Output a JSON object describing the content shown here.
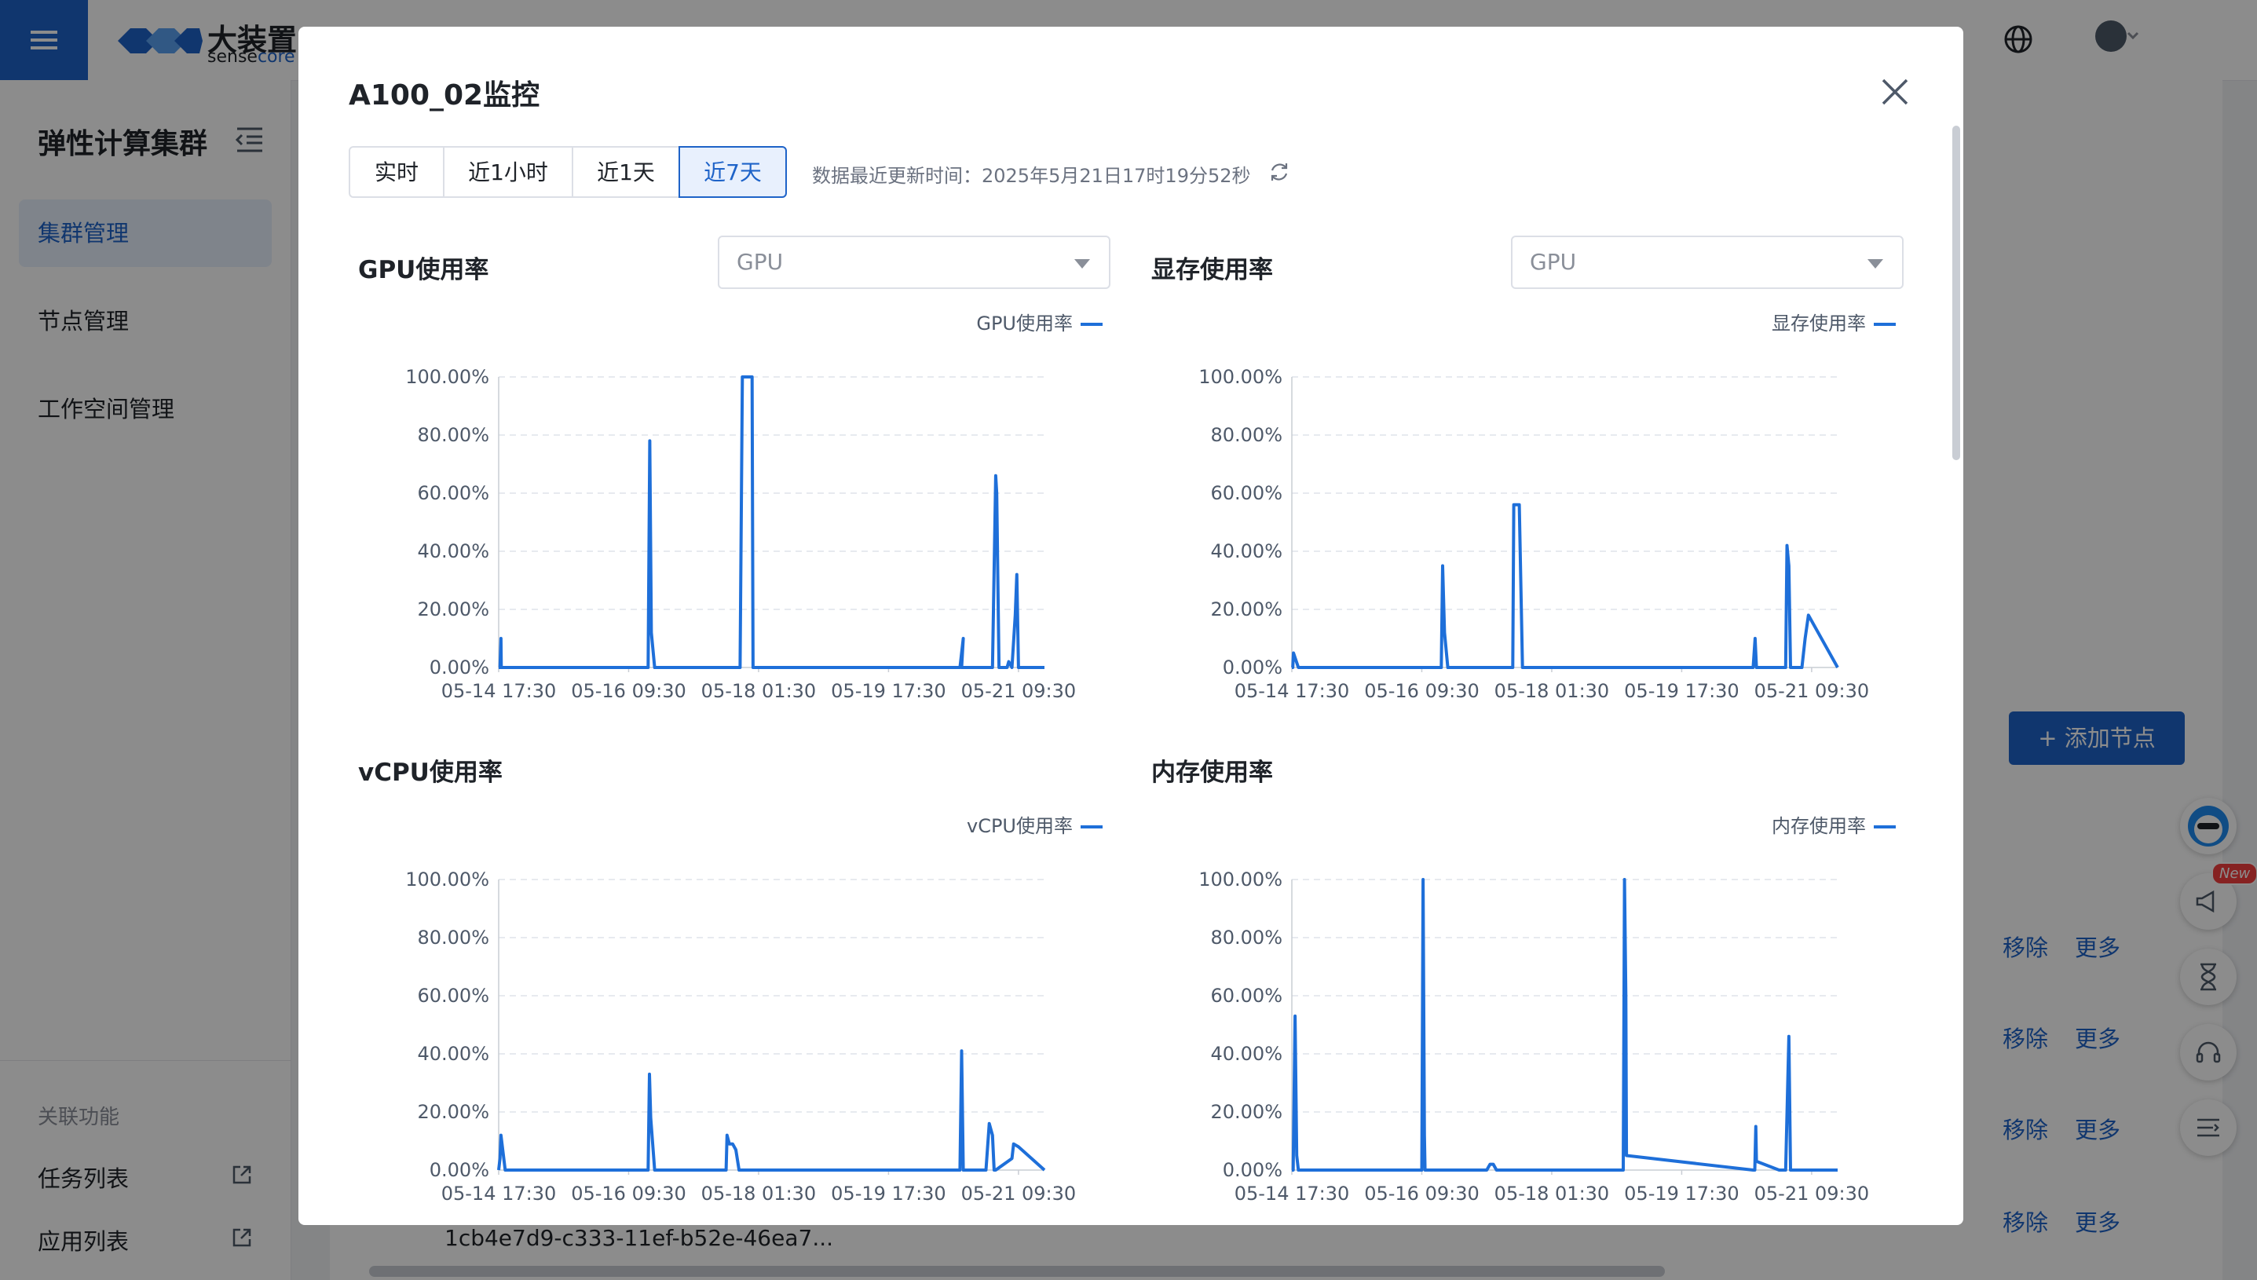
{
  "app": {
    "logo_title": "大装置",
    "logo_sub_prefix": "sense",
    "logo_sub_accent": "core"
  },
  "sidebar": {
    "title": "弹性计算集群",
    "items": [
      {
        "label": "集群管理",
        "active": true
      },
      {
        "label": "节点管理",
        "active": false
      },
      {
        "label": "工作空间管理",
        "active": false
      }
    ],
    "related_label": "关联功能",
    "links": [
      {
        "label": "任务列表"
      },
      {
        "label": "应用列表"
      }
    ]
  },
  "background": {
    "add_node_button": "+ 添加节点",
    "row_actions": [
      {
        "remove": "移除",
        "more": "更多"
      },
      {
        "remove": "移除",
        "more": "更多"
      },
      {
        "remove": "移除",
        "more": "更多"
      },
      {
        "remove": "移除",
        "more": "更多"
      }
    ],
    "row_id": "1cb4e7d9-c333-11ef-b52e-46ea7...",
    "new_badge": "New"
  },
  "modal": {
    "title": "A100_02监控",
    "time_ranges": [
      "实时",
      "近1小时",
      "近1天",
      "近7天"
    ],
    "active_range": "近7天",
    "update_label": "数据最近更新时间：2025年5月21日17时19分52秒",
    "gpu_select_placeholder": "GPU",
    "mem_select_placeholder": "GPU"
  },
  "colors": {
    "accent": "#1e63c8",
    "series": "#1e6fd9",
    "grid": "#dfe3ea"
  },
  "chart_data": [
    {
      "type": "line",
      "title": "GPU使用率",
      "legend": [
        "GPU使用率"
      ],
      "legend_position": "top-right",
      "x_tick_labels": [
        "05-14 17:30",
        "05-16 09:30",
        "05-18 01:30",
        "05-19 17:30",
        "05-21 09:30"
      ],
      "y_tick_labels": [
        "0.00%",
        "20.00%",
        "40.00%",
        "60.00%",
        "80.00%",
        "100.00%"
      ],
      "ylim": [
        0,
        100
      ],
      "xlim_hours": [
        0,
        168
      ],
      "grid": true,
      "series": [
        {
          "name": "GPU使用率",
          "x_hours_since_first_tick": [
            0,
            0.4,
            0.7,
            0.8,
            2,
            46,
            46.5,
            47,
            48,
            60,
            74.3,
            75,
            76,
            78,
            78.3,
            80,
            142,
            143,
            142.5,
            152,
            153,
            153.3,
            154,
            155,
            156,
            156.5,
            157,
            158,
            159,
            159.5,
            160,
            168
          ],
          "y": [
            0,
            0,
            10,
            0,
            0,
            0,
            78,
            12,
            0,
            0,
            0,
            100,
            100,
            100,
            0,
            0,
            0,
            10,
            0,
            0,
            66,
            60,
            0,
            0,
            0,
            0,
            2,
            0,
            18,
            32,
            0,
            0
          ]
        }
      ]
    },
    {
      "type": "line",
      "title": "显存使用率",
      "legend": [
        "显存使用率"
      ],
      "legend_position": "top-right",
      "x_tick_labels": [
        "05-14 17:30",
        "05-16 09:30",
        "05-18 01:30",
        "05-19 17:30",
        "05-21 09:30"
      ],
      "y_tick_labels": [
        "0.00%",
        "20.00%",
        "40.00%",
        "60.00%",
        "80.00%",
        "100.00%"
      ],
      "ylim": [
        0,
        100
      ],
      "xlim_hours": [
        0,
        168
      ],
      "grid": true,
      "series": [
        {
          "name": "显存使用率",
          "x_hours_since_first_tick": [
            0,
            0.3,
            0.5,
            2,
            46,
            46.4,
            47,
            48,
            60,
            62,
            68,
            68.3,
            69.5,
            70,
            71,
            142,
            142.6,
            143,
            152,
            152.4,
            153,
            153.5,
            155,
            156,
            157,
            158,
            159,
            168
          ],
          "y": [
            0,
            0,
            5,
            0,
            0,
            35,
            12,
            0,
            0,
            0,
            0,
            56,
            56,
            56,
            0,
            0,
            10,
            0,
            0,
            42,
            35,
            0,
            0,
            0,
            0,
            10,
            18,
            0
          ]
        }
      ]
    },
    {
      "type": "line",
      "title": "vCPU使用率",
      "legend": [
        "vCPU使用率"
      ],
      "legend_position": "top-right",
      "x_tick_labels": [
        "05-14 17:30",
        "05-16 09:30",
        "05-18 01:30",
        "05-19 17:30",
        "05-21 09:30"
      ],
      "y_tick_labels": [
        "0.00%",
        "20.00%",
        "40.00%",
        "60.00%",
        "80.00%",
        "100.00%"
      ],
      "ylim": [
        0,
        100
      ],
      "xlim_hours": [
        0,
        168
      ],
      "grid": true,
      "series": [
        {
          "name": "vCPU使用率",
          "x_hours_since_first_tick": [
            0,
            0.4,
            0.7,
            2,
            46,
            46.4,
            46.8,
            48,
            70,
            70.3,
            71,
            72,
            73,
            74,
            142,
            142.5,
            143,
            150,
            151,
            152,
            152.5,
            153,
            158,
            158.5,
            160,
            168
          ],
          "y": [
            0,
            4,
            12,
            0,
            0,
            33,
            18,
            0,
            0,
            12,
            9,
            9,
            7,
            0,
            0,
            41,
            0,
            0,
            16,
            12,
            0,
            0,
            4,
            9,
            8,
            0
          ]
        }
      ]
    },
    {
      "type": "line",
      "title": "内存使用率",
      "legend": [
        "内存使用率"
      ],
      "legend_position": "top-right",
      "x_tick_labels": [
        "05-14 17:30",
        "05-16 09:30",
        "05-18 01:30",
        "05-19 17:30",
        "05-21 09:30"
      ],
      "y_tick_labels": [
        "0.00%",
        "20.00%",
        "40.00%",
        "60.00%",
        "80.00%",
        "100.00%"
      ],
      "ylim": [
        0,
        100
      ],
      "xlim_hours": [
        0,
        168
      ],
      "grid": true,
      "series": [
        {
          "name": "内存使用率",
          "x_hours_since_first_tick": [
            0,
            0.4,
            1,
            1.5,
            2,
            40,
            40.4,
            40.8,
            41,
            60,
            61,
            62,
            63,
            70,
            100,
            102,
            102.4,
            102.8,
            103,
            142,
            142.5,
            142.8,
            143,
            150,
            151,
            152,
            153,
            153.5,
            154,
            160,
            168
          ],
          "y": [
            0,
            0,
            53,
            5,
            0,
            0,
            100,
            12,
            0,
            0,
            2,
            2,
            0,
            0,
            0,
            0,
            100,
            60,
            5,
            0,
            0,
            15,
            3,
            0,
            0,
            0,
            46,
            0,
            0,
            0,
            0
          ]
        }
      ]
    }
  ]
}
